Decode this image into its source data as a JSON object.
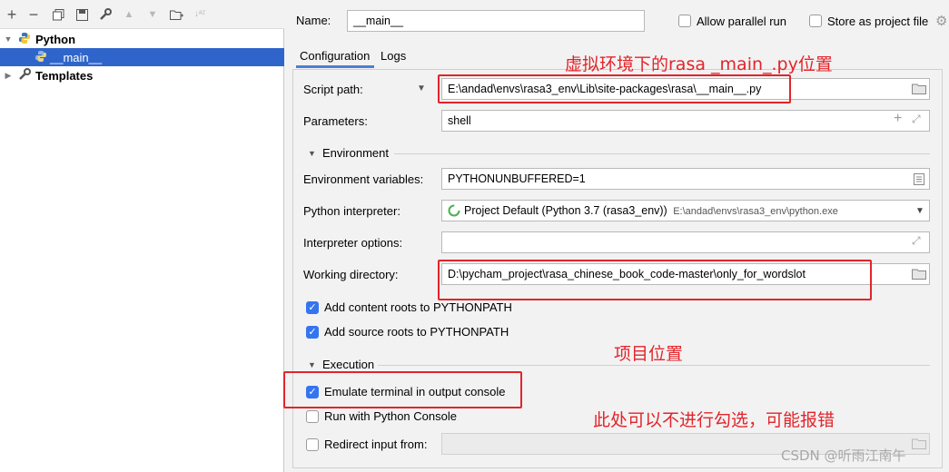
{
  "left_panel": {
    "toolbar": {
      "add_icon": "plus-icon",
      "remove_icon": "minus-icon",
      "copy_icon": "copy-icon",
      "save_icon": "save-icon",
      "edit_icon": "wrench-icon",
      "up_icon": "arrow-up-icon",
      "down_icon": "arrow-down-icon",
      "folder_icon": "new-folder-icon",
      "sort_icon": "sort-az-icon"
    },
    "tree": [
      {
        "label": "Python",
        "expanded": true
      },
      {
        "label": "__main__",
        "selected": true
      },
      {
        "label": "Templates",
        "expanded": false
      }
    ]
  },
  "header": {
    "name_label": "Name:",
    "name_value": "__main__",
    "allow_parallel_label": "Allow parallel run",
    "store_as_project_label": "Store as project file"
  },
  "tabs": [
    "Configuration",
    "Logs"
  ],
  "form": {
    "script_path_label": "Script path:",
    "script_path_value": "E:\\andad\\envs\\rasa3_env\\Lib\\site-packages\\rasa\\__main__.py",
    "parameters_label": "Parameters:",
    "parameters_value": "shell",
    "environment_section": "Environment",
    "env_vars_label": "Environment variables:",
    "env_vars_value": "PYTHONUNBUFFERED=1",
    "interpreter_label": "Python interpreter:",
    "interpreter_value": "Project Default (Python 3.7 (rasa3_env))",
    "interpreter_path": "E:\\andad\\envs\\rasa3_env\\python.exe",
    "interpreter_options_label": "Interpreter options:",
    "interpreter_options_value": "",
    "working_dir_label": "Working directory:",
    "working_dir_value": "D:\\pycham_project\\rasa_chinese_book_code-master\\only_for_wordslot",
    "add_content_roots_label": "Add content roots to PYTHONPATH",
    "add_source_roots_label": "Add source roots to PYTHONPATH",
    "execution_section": "Execution",
    "emulate_terminal_label": "Emulate terminal in output console",
    "run_python_console_label": "Run with Python Console",
    "redirect_input_label": "Redirect input from:",
    "redirect_input_value": ""
  },
  "checkboxes": {
    "allow_parallel": false,
    "store_as_project": false,
    "add_content_roots": true,
    "add_source_roots": true,
    "emulate_terminal": true,
    "run_python_console": false,
    "redirect_input": false
  },
  "annotations": {
    "script_note": "虚拟环境下的rasa _main_.py位置",
    "project_note": "项目位置",
    "checkbox_note": "此处可以不进行勾选，可能报错",
    "watermark": "CSDN @听雨江南午"
  },
  "colors": {
    "selection": "#2f65ca",
    "annotation_red": "#e3242b",
    "checkbox_blue": "#3574f0"
  }
}
